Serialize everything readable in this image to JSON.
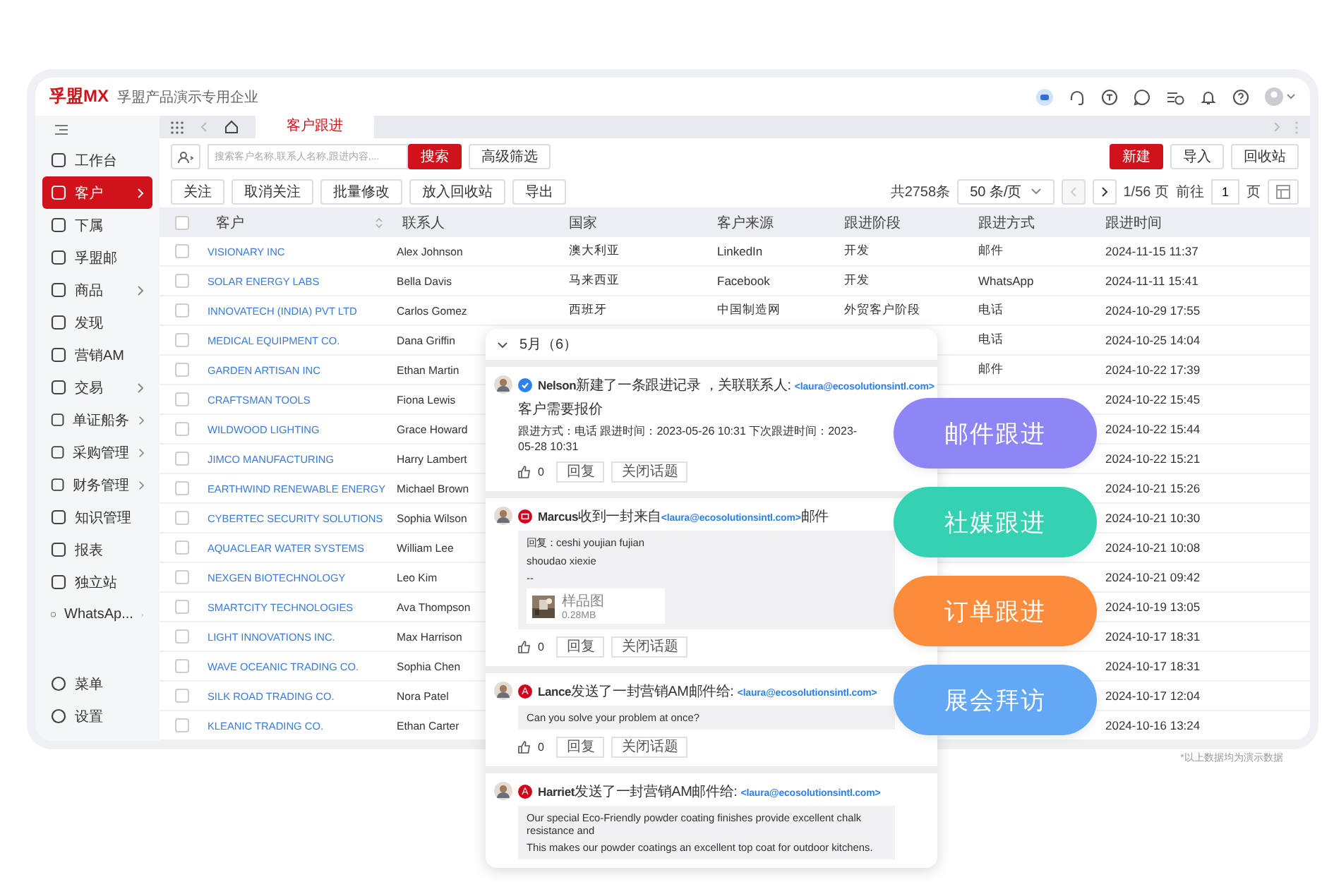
{
  "header": {
    "logo": "孚盟MX",
    "company": "孚盟产品演示专用企业"
  },
  "sidebar": {
    "items": [
      {
        "label": "工作台",
        "selected": false,
        "expandable": false
      },
      {
        "label": "客户",
        "selected": true,
        "expandable": true
      },
      {
        "label": "下属",
        "selected": false,
        "expandable": false
      },
      {
        "label": "孚盟邮",
        "selected": false,
        "expandable": false
      },
      {
        "label": "商品",
        "selected": false,
        "expandable": true
      },
      {
        "label": "发现",
        "selected": false,
        "expandable": false
      },
      {
        "label": "营销AM",
        "selected": false,
        "expandable": false
      },
      {
        "label": "交易",
        "selected": false,
        "expandable": true
      },
      {
        "label": "单证船务",
        "selected": false,
        "expandable": true
      },
      {
        "label": "采购管理",
        "selected": false,
        "expandable": true
      },
      {
        "label": "财务管理",
        "selected": false,
        "expandable": true
      },
      {
        "label": "知识管理",
        "selected": false,
        "expandable": false
      },
      {
        "label": "报表",
        "selected": false,
        "expandable": false
      },
      {
        "label": "独立站",
        "selected": false,
        "expandable": false
      },
      {
        "label": "WhatsAp...",
        "selected": false,
        "expandable": true
      }
    ],
    "bottom_items": [
      "菜单",
      "设置"
    ]
  },
  "tabs": [
    {
      "label": "客户跟进",
      "selected": true
    }
  ],
  "toolbar": {
    "search_placeholder": "搜索客户名称,联系人名称,跟进内容,...",
    "search_button": "搜索",
    "filter_button": "高级筛选",
    "right_buttons": [
      {
        "label": "新建",
        "primary": true
      },
      {
        "label": "导入",
        "primary": false
      },
      {
        "label": "回收站",
        "primary": false
      }
    ]
  },
  "actions": [
    "关注",
    "取消关注",
    "批量修改",
    "放入回收站",
    "导出"
  ],
  "pagination": {
    "total": "共2758条",
    "page_size": "50 条/页",
    "prev_disabled": true,
    "page": "1/56 页",
    "goto_label": "前往",
    "goto_value": "1",
    "page_unit": "页"
  },
  "table": {
    "select_all_checked": false,
    "columns": [
      "客户",
      "联系人",
      "国家",
      "客户来源",
      "跟进阶段",
      "跟进方式",
      "跟进时间"
    ],
    "rows": [
      {
        "checked": false,
        "customer": "VISIONARY INC",
        "contact": "Alex Johnson",
        "country": "澳大利亚",
        "source": "LinkedIn",
        "stage": "开发",
        "method": "邮件",
        "time": "2024-11-15 11:37"
      },
      {
        "checked": false,
        "customer": "SOLAR ENERGY LABS",
        "contact": "Bella Davis",
        "country": "马来西亚",
        "source": "Facebook",
        "stage": "开发",
        "method": "WhatsApp",
        "time": "2024-11-11 15:41"
      },
      {
        "checked": false,
        "customer": "INNOVATECH (INDIA) PVT LTD",
        "contact": "Carlos Gomez",
        "country": "西班牙",
        "source": "中国制造网",
        "stage": "外贸客户阶段",
        "method": "电话",
        "time": "2024-10-29 17:55"
      },
      {
        "checked": false,
        "customer": "MEDICAL EQUIPMENT CO.",
        "contact": "Dana Griffin",
        "method": "电话",
        "time": "2024-10-25 14:04"
      },
      {
        "checked": false,
        "customer": "GARDEN ARTISAN INC",
        "contact": "Ethan Martin",
        "method": "邮件",
        "time": "2024-10-22 17:39"
      },
      {
        "checked": false,
        "customer": "CRAFTSMAN TOOLS",
        "contact": "Fiona Lewis",
        "time": "2024-10-22 15:45"
      },
      {
        "checked": false,
        "customer": "WILDWOOD LIGHTING",
        "contact": "Grace Howard",
        "time": "2024-10-22 15:44"
      },
      {
        "checked": false,
        "customer": "JIMCO MANUFACTURING",
        "contact": "Harry Lambert",
        "time": "2024-10-22 15:21"
      },
      {
        "checked": false,
        "customer": "EARTHWIND RENEWABLE ENERGY",
        "contact": "Michael Brown",
        "time": "2024-10-21 15:26"
      },
      {
        "checked": false,
        "customer": "CYBERTEC SECURITY SOLUTIONS",
        "contact": "Sophia Wilson",
        "time": "2024-10-21 10:30"
      },
      {
        "checked": false,
        "customer": "AQUACLEAR WATER SYSTEMS",
        "contact": "William Lee",
        "time": "2024-10-21 10:08"
      },
      {
        "checked": false,
        "customer": "NEXGEN BIOTECHNOLOGY",
        "contact": "Leo Kim",
        "time": "2024-10-21 09:42"
      },
      {
        "checked": false,
        "customer": "SMARTCITY TECHNOLOGIES",
        "contact": "Ava Thompson",
        "time": "2024-10-19 13:05"
      },
      {
        "checked": false,
        "customer": "LIGHT INNOVATIONS INC.",
        "contact": "Max Harrison",
        "time": "2024-10-17 18:31"
      },
      {
        "checked": false,
        "customer": "WAVE OCEANIC TRADING CO.",
        "contact": "Sophia Chen",
        "time": "2024-10-17 18:31"
      },
      {
        "checked": false,
        "customer": "SILK ROAD TRADING CO.",
        "contact": "Nora Patel",
        "time": "2024-10-17 12:04"
      },
      {
        "checked": false,
        "customer": "KLEANIC TRADING CO.",
        "contact": "Ethan Carter",
        "time": "2024-10-16 13:24"
      }
    ]
  },
  "footnote": "*以上数据均为演示数据",
  "timeline": {
    "heading": "5月（6）",
    "expanded": true,
    "entries": [
      {
        "kind": "followup",
        "color": "#2f80ed",
        "author": "Nelson",
        "action": "新建了一条跟进记录 ，关联联系人: ",
        "email": "<laura@ecosolutionsintl.com>",
        "body": [
          "客户需要报价"
        ],
        "meta": "跟进方式：电话   跟进时间：2023-05-26 10:31   下次跟进时间：2023-05-28 10:31",
        "likes": "0",
        "buttons": [
          "回复",
          "关闭话题"
        ]
      },
      {
        "kind": "email",
        "color": "#d0021b",
        "author": "Marcus",
        "action": "收到一封来自",
        "email": "<laura@ecosolutionsintl.com>",
        "suffix": "邮件",
        "quote": [
          "回复：ceshi youjian fujian",
          "shoudao xiexie",
          "--"
        ],
        "attachment": {
          "name": "样品图",
          "size": "0.28MB"
        },
        "likes": "0",
        "buttons": [
          "回复",
          "关闭话题"
        ]
      },
      {
        "kind": "marketing",
        "color": "#d0021b",
        "badge": "A",
        "author": "Lance",
        "action": "发送了一封营销AM邮件给: ",
        "email": "<laura@ecosolutionsintl.com>",
        "quote": [
          "Can you solve your problem at once?"
        ],
        "likes": "0",
        "buttons": [
          "回复",
          "关闭话题"
        ]
      },
      {
        "kind": "marketing",
        "color": "#d0021b",
        "badge": "A",
        "author": "Harriet",
        "action": "发送了一封营销AM邮件给: ",
        "email": "<laura@ecosolutionsintl.com>",
        "quote": [
          "Our special Eco-Friendly powder coating finishes provide excellent chalk resistance and",
          "This makes our powder coatings an excellent top coat for outdoor kitchens."
        ]
      }
    ]
  },
  "feature_pills": [
    {
      "label": "邮件跟进",
      "color": "#8f86f5"
    },
    {
      "label": "社媒跟进",
      "color": "#34d1b2"
    },
    {
      "label": "订单跟进",
      "color": "#fb8c3c"
    },
    {
      "label": "展会拜访",
      "color": "#63a8f5"
    }
  ]
}
